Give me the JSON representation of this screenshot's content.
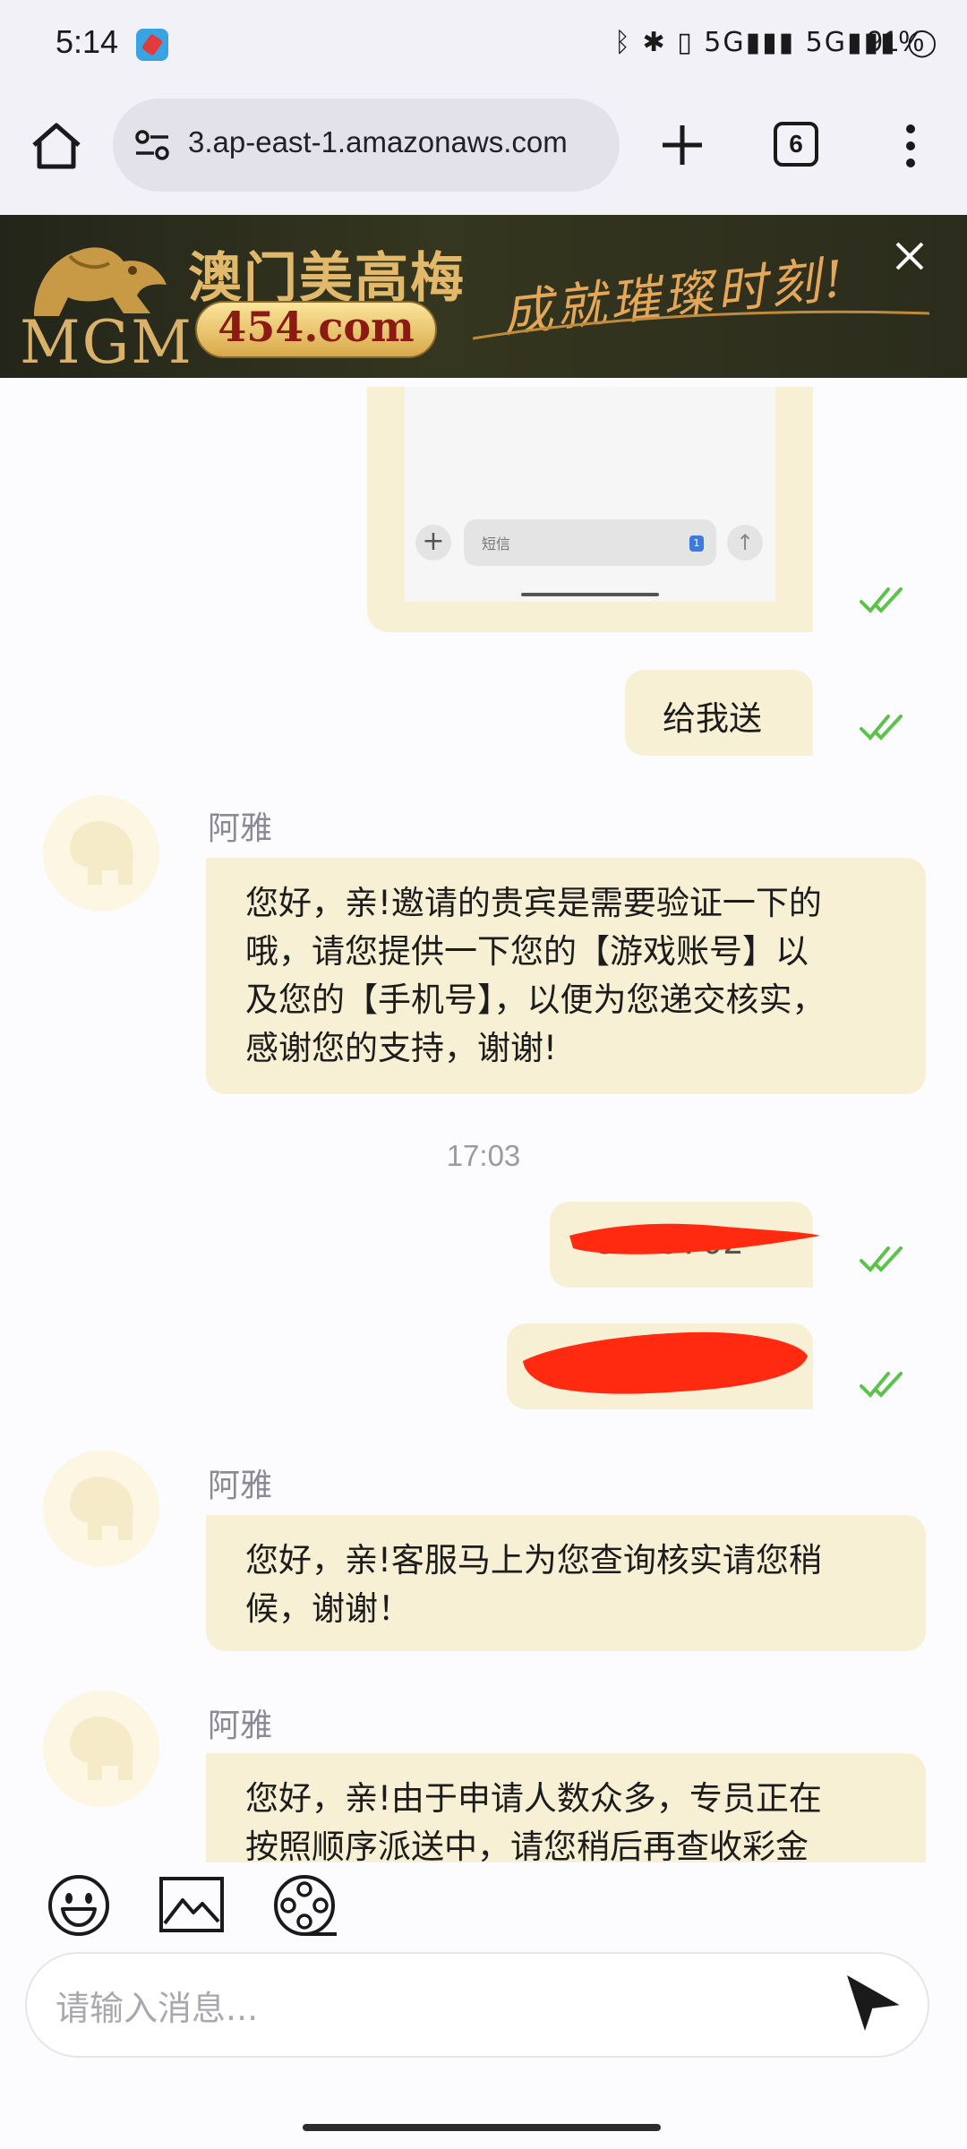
{
  "status_bar": {
    "time": "5:14",
    "icons": "ᛒ ✱ ▯ 5G▮▮▮ 5G▮▮▮ ◯",
    "battery": "91%"
  },
  "browser": {
    "url": "3.ap-east-1.amazonaws.com",
    "tab_count": "6"
  },
  "banner": {
    "brand_latin": "MGM",
    "brand_cn": "澳门美高梅",
    "domain": "454.com",
    "slogan": "成就璀璨时刻!"
  },
  "chat": {
    "screenshot_preview": {
      "input_placeholder": "短信",
      "badge": "1"
    },
    "messages": [
      {
        "direction": "out",
        "text": "给我送"
      },
      {
        "direction": "in",
        "sender": "阿雅",
        "lines": [
          "您好，亲!邀请的贵宾是需要验证一下的",
          "哦，请您提供一下您的【游戏账号】以",
          "及您的【手机号】，以便为您递交核实，",
          "感谢您的支持，谢谢!"
        ]
      },
      {
        "direction": "in",
        "sender": "阿雅",
        "lines": [
          "您好，亲!客服马上为您查询核实请您稍",
          "候，谢谢！"
        ]
      },
      {
        "direction": "in",
        "sender": "阿雅",
        "lines": [
          "您好，亲!由于申请人数众多，专员正在",
          "按照顺序派送中，请您稍后再查收彩金"
        ]
      }
    ],
    "timestamp": "17:03",
    "redacted_fragment": "9009702"
  },
  "input": {
    "placeholder": "请输入消息..."
  },
  "colors": {
    "bubble": "#f8f0d4",
    "check": "#5cc24a",
    "redaction": "#ff2a10"
  }
}
